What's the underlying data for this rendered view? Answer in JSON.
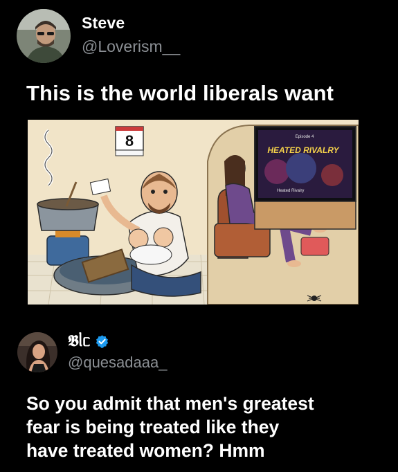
{
  "original_post": {
    "author_name": "Steve",
    "handle": "@Loverism__",
    "text": "This is the world liberals want",
    "image": {
      "calendar_number": "8",
      "tv_show_title": "HEATED RIVALRY",
      "tv_episode_label": "Episode 4",
      "tv_caption": "Heated Rivalry"
    }
  },
  "reply": {
    "author_name": "𝕭ᥣᥴ",
    "verified": true,
    "handle": "@quesadaaa_",
    "text_lines": [
      "So you admit that men's greatest",
      "fear is being treated like they",
      "have treated women? Hmm"
    ]
  },
  "colors": {
    "background": "#000000",
    "text_primary": "#ffffff",
    "text_secondary": "#8b8f94",
    "verified_blue": "#1d9bf0"
  },
  "icons": [
    "verified-badge-icon"
  ]
}
